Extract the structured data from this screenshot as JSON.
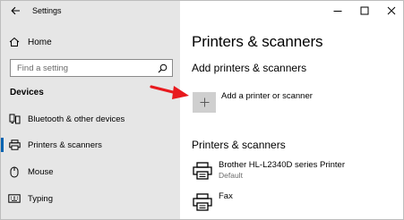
{
  "window": {
    "title": "Settings"
  },
  "sidebar": {
    "home_label": "Home",
    "search_placeholder": "Find a setting",
    "section_title": "Devices",
    "items": [
      {
        "label": "Bluetooth & other devices",
        "icon": "bluetooth-devices-icon"
      },
      {
        "label": "Printers & scanners",
        "icon": "printer-icon",
        "selected": true
      },
      {
        "label": "Mouse",
        "icon": "mouse-icon"
      },
      {
        "label": "Typing",
        "icon": "keyboard-icon"
      }
    ]
  },
  "main": {
    "title": "Printers & scanners",
    "add_section_title": "Add printers & scanners",
    "add_label": "Add a printer or scanner",
    "list_title": "Printers & scanners",
    "printers": [
      {
        "name": "Brother HL-L2340D series Printer",
        "status": "Default"
      },
      {
        "name": "Fax",
        "status": ""
      }
    ]
  },
  "colors": {
    "sidebar_bg": "#e6e6e6",
    "accent": "#0063b1",
    "annotation_arrow": "#e8191d",
    "tile_bg": "#cfcfcf"
  }
}
